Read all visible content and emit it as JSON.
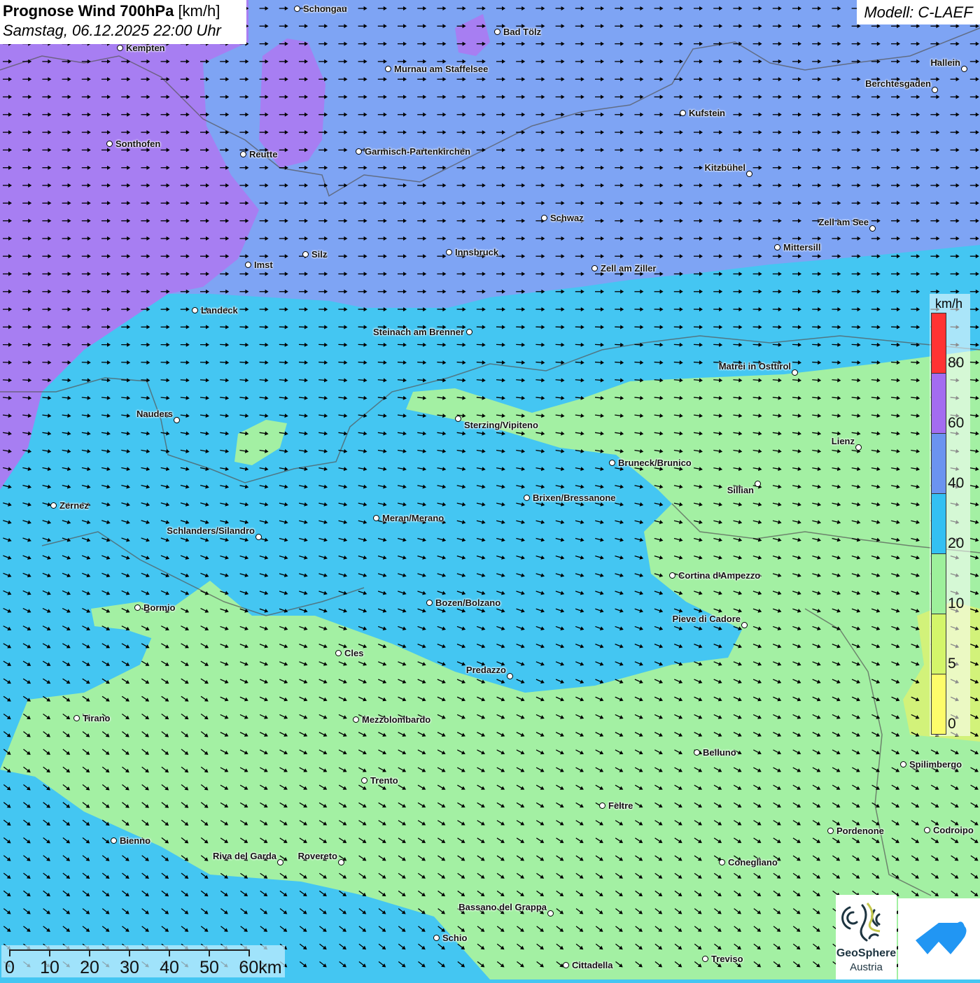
{
  "header": {
    "title_bold": "Prognose Wind 700hPa",
    "title_unit": "[km/h]",
    "datetime": "Samstag, 06.12.2025 22:00 Uhr",
    "model": "Modell: C-LAEF"
  },
  "legend": {
    "unit": "km/h",
    "labels": [
      "80",
      "60",
      "40",
      "20",
      "10",
      "5",
      "0"
    ],
    "colors": [
      "#ff3333",
      "#a36cf0",
      "#6b93f0",
      "#33c0f2",
      "#9df09b",
      "#d4f56a",
      "#fdfc6a"
    ]
  },
  "scale_bar": {
    "labels": [
      "0",
      "10",
      "20",
      "30",
      "40",
      "50",
      "60km"
    ]
  },
  "logos": {
    "geosphere_line1": "GeoSphere",
    "geosphere_line2": "Austria"
  },
  "cities": [
    "Schongau",
    "Bad Tölz",
    "Kempten",
    "Murnau am Staffelsee",
    "Hallein",
    "Berchtesgaden",
    "Kufstein",
    "Sonthofen",
    "Reutte",
    "Garmisch-Partenkirchen",
    "Kitzbühel",
    "Schwaz",
    "Zell am See",
    "Mittersill",
    "Innsbruck",
    "Silz",
    "Imst",
    "Zell am Ziller",
    "Landeck",
    "Steinach am Brenner",
    "Matrei in Osttirol",
    "Nauders",
    "Sterzing/Vipiteno",
    "Lienz",
    "Bruneck/Brunico",
    "Sillian",
    "Brixen/Bressanone",
    "Zernez",
    "Meran/Merano",
    "Schlanders/Silandro",
    "Cortina d'Ampezzo",
    "Bozen/Bolzano",
    "Bormio",
    "Pieve di Cadore",
    "Cles",
    "Predazzo",
    "Tirano",
    "Mezzolombardo",
    "Belluno",
    "Spilimbergo",
    "Trento",
    "Feltre",
    "Pordenone",
    "Codroipo",
    "Bienno",
    "Riva del Garda",
    "Rovereto",
    "Conegliano",
    "Bassano del Grappa",
    "Schio",
    "Treviso",
    "Cittadella"
  ]
}
